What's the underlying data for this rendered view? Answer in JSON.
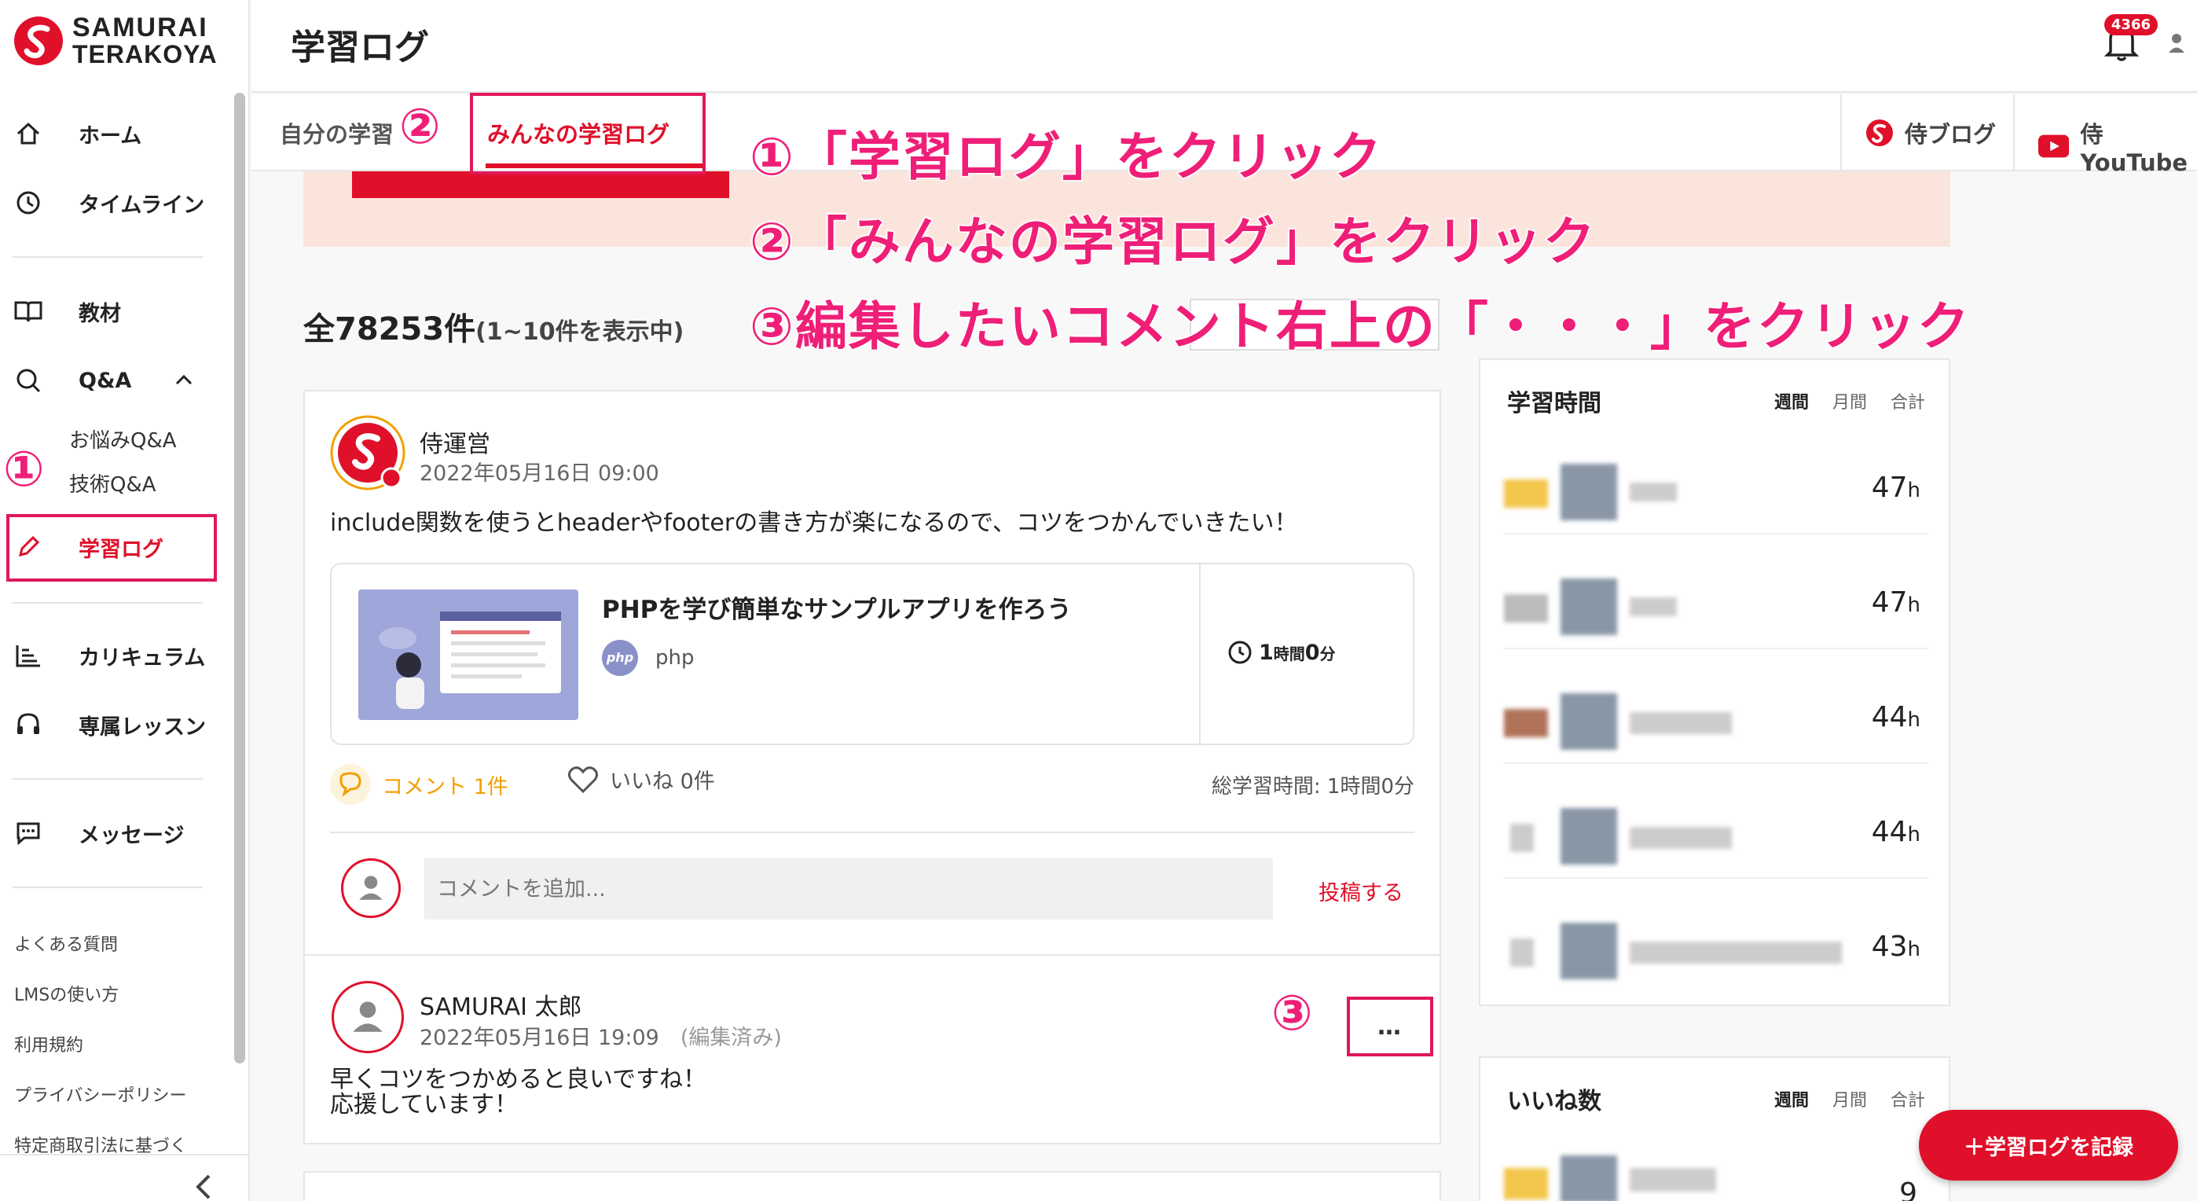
{
  "brand": {
    "line1": "SAMURAI",
    "line2": "TERAKOYA"
  },
  "header": {
    "title": "学習ログ",
    "notifications": "4366"
  },
  "sidebar": {
    "items": [
      {
        "label": "ホーム",
        "icon": "home-icon"
      },
      {
        "label": "タイムライン",
        "icon": "clock-icon"
      },
      {
        "label": "教材",
        "icon": "book-icon"
      },
      {
        "label": "Q&A",
        "icon": "search-icon"
      },
      {
        "label": "学習ログ",
        "icon": "pencil-icon"
      },
      {
        "label": "カリキュラム",
        "icon": "chart-icon"
      },
      {
        "label": "専属レッスン",
        "icon": "headset-icon"
      },
      {
        "label": "メッセージ",
        "icon": "chat-icon"
      }
    ],
    "qa_sub": [
      "お悩みQ&A",
      "技術Q&A"
    ],
    "footer_links": [
      "よくある質問",
      "LMSの使い方",
      "利用規約",
      "プライバシーポリシー",
      "特定商取引法に基づく"
    ]
  },
  "tabs": {
    "mine": "自分の学習",
    "all": "みんなの学習ログ"
  },
  "external": {
    "blog": "侍ブログ",
    "youtube": "侍YouTube"
  },
  "list": {
    "count": "全78253件",
    "range": "(1~10件を表示中)"
  },
  "post": {
    "author": "侍運営",
    "date": "2022年05月16日 09:00",
    "text": "include関数を使うとheaderやfooterの書き方が楽になるので、コツをつかんでいきたい！",
    "course_title": "PHPを学び簡単なサンプルアプリを作ろう",
    "course_tag_icon": "php",
    "course_tag": "php",
    "course_time_h": "1",
    "course_time_h_unit": "時間",
    "course_time_m": "0",
    "course_time_m_unit": "分",
    "comment_action": "コメント 1件",
    "like_action": "いいね 0件",
    "total_time": "総学習時間: 1時間0分",
    "comment_placeholder": "コメントを追加...",
    "post_button": "投稿する"
  },
  "reply": {
    "author": "SAMURAI 太郎",
    "date": "2022年05月16日 19:09",
    "edited": "(編集済み)",
    "line1": "早くコツをつかめると良いですね！",
    "line2": "応援しています！",
    "menu": "…"
  },
  "ranking": {
    "study_title": "学習時間",
    "likes_title": "いいね数",
    "period_tabs": [
      "週間",
      "月間",
      "合計"
    ],
    "hours": [
      "47",
      "47",
      "44",
      "44",
      "43"
    ],
    "hour_unit": "h",
    "likes_first": "9"
  },
  "fab": "＋学習ログを記録",
  "annotations": {
    "step1": "①「学習ログ」をクリック",
    "step2": "②「みんなの学習ログ」をクリック",
    "step3": "③編集したいコメント右上の「",
    "step3_dots": "・・・",
    "step3_end": "」をクリック",
    "marker1": "①",
    "marker2": "②",
    "marker3": "③"
  },
  "colors": {
    "accent": "#e0102a",
    "annotation": "#ef1f78",
    "banner": "#fbe4dc",
    "comment": "#f0a000"
  }
}
